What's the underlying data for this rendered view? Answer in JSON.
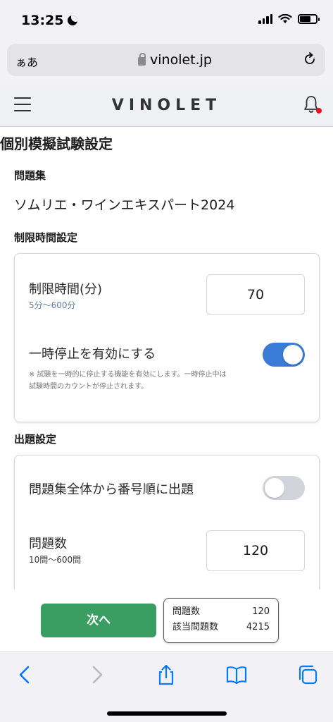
{
  "status_bar": {
    "time": "13:25"
  },
  "browser": {
    "text_size_label": "ぁあ",
    "url": "vinolet.jp"
  },
  "site": {
    "logo": "VINOLET"
  },
  "page": {
    "title": "個別模擬試験設定",
    "collection_label": "問題集",
    "collection_name": "ソムリエ・ワインエキスパート2024",
    "time_section_label": "制限時間設定",
    "time_limit": {
      "label": "制限時間(分)",
      "hint": "5分〜600分",
      "value": "70"
    },
    "pause": {
      "label": "一時停止を有効にする",
      "enabled": true,
      "note": "※ 試験を一時的に停止する機能を有効にします。一時停止中は試験時間のカウントが停止されます。"
    },
    "question_section_label": "出題設定",
    "sequential": {
      "label": "問題集全体から番号順に出題",
      "enabled": false
    },
    "question_count": {
      "label": "問題数",
      "hint": "10問〜600問",
      "value": "120"
    }
  },
  "action_bar": {
    "next_label": "次へ",
    "summary": {
      "count_label": "問題数",
      "count_value": "120",
      "matching_label": "該当問題数",
      "matching_value": "4215"
    }
  },
  "colors": {
    "primary_green": "#3a9e63",
    "toggle_on": "#3a7bd5",
    "notification_dot": "#e8111c",
    "ios_blue": "#007aff"
  }
}
